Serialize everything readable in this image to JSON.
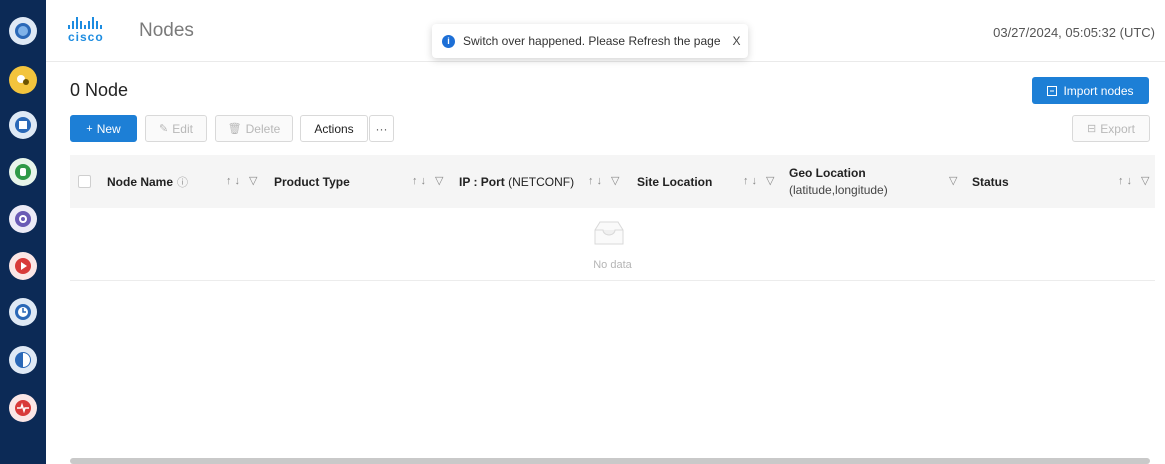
{
  "header": {
    "logo_text": "cisco",
    "title": "Nodes",
    "datetime": "03/27/2024, 05:05:32 (UTC)"
  },
  "toast": {
    "message": "Switch over happened. Please Refresh the page",
    "close_label": "X",
    "icon": "info-icon"
  },
  "page": {
    "count_label": "0 Node",
    "import_label": "Import nodes"
  },
  "toolbar": {
    "new_label": "New",
    "edit_label": "Edit",
    "delete_label": "Delete",
    "actions_label": "Actions",
    "more_label": "···",
    "export_label": "Export"
  },
  "table": {
    "columns": {
      "node_name": "Node Name",
      "product_type": "Product Type",
      "ip_port_bold": "IP : Port",
      "ip_port_light": "(NETCONF)",
      "site_location": "Site Location",
      "geo_location_title": "Geo Location",
      "geo_location_sub": "(latitude,longitude)",
      "status": "Status"
    },
    "empty_text": "No data"
  },
  "colors": {
    "rail": "#0c2a56",
    "accent": "#1d7fd6",
    "brand": "#1d8ce0"
  },
  "rail_icons": [
    "globe-icon",
    "tools-icon",
    "storage-icon",
    "database-icon",
    "search-gear-icon",
    "play-icon",
    "clock-icon",
    "compass-icon",
    "pulse-icon"
  ]
}
